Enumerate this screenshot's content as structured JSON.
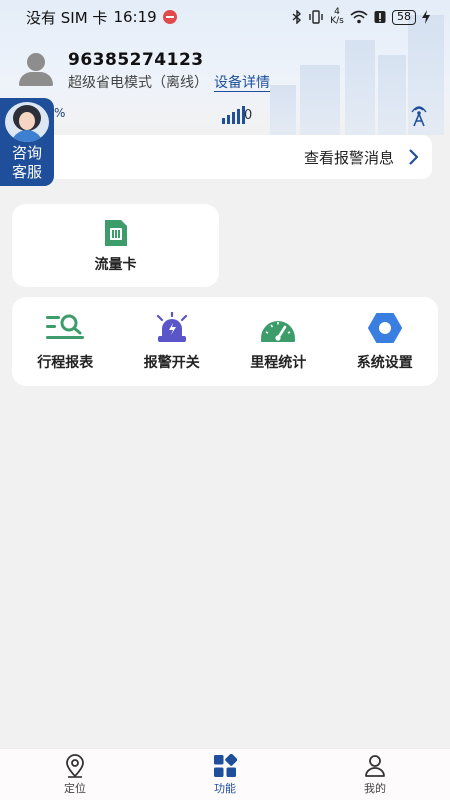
{
  "status_bar": {
    "carrier": "没有 SIM 卡",
    "time": "16:19",
    "speed": "4 K/s",
    "battery": "58"
  },
  "device": {
    "id": "96385274123",
    "mode": "超级省电模式（离线）",
    "detail_link": "设备详情",
    "battery_pct": "%",
    "signal_value": "0"
  },
  "service": {
    "label": "咨询客服"
  },
  "alarm": {
    "label": "查看报警消息"
  },
  "sim_card": {
    "label": "流量卡",
    "icon": "sim-card-icon",
    "color": "#3c9d6a"
  },
  "functions": [
    {
      "label": "行程报表",
      "icon": "trip-report-icon",
      "color": "#3c9d6a"
    },
    {
      "label": "报警开关",
      "icon": "alarm-siren-icon",
      "color": "#5a55c9"
    },
    {
      "label": "里程统计",
      "icon": "speedometer-icon",
      "color": "#3c9d6a"
    },
    {
      "label": "系统设置",
      "icon": "settings-hex-icon",
      "color": "#3a7fe0"
    }
  ],
  "tabs": [
    {
      "label": "定位",
      "icon": "location-pin-icon",
      "active": false
    },
    {
      "label": "功能",
      "icon": "function-grid-icon",
      "active": true
    },
    {
      "label": "我的",
      "icon": "user-icon",
      "active": false
    }
  ],
  "colors": {
    "primary": "#1f4f9a",
    "background": "#f1f1f1"
  }
}
